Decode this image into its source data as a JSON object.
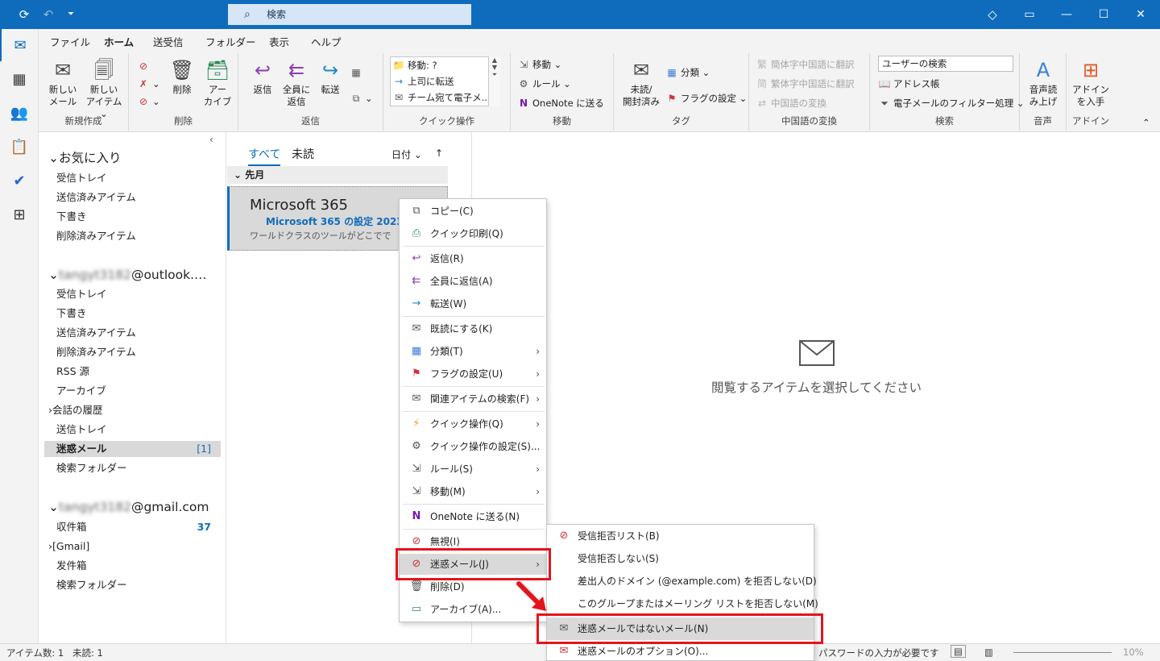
{
  "titlebar": {
    "search_placeholder": "検索"
  },
  "tabs": [
    "ファイル",
    "ホーム",
    "送受信",
    "フォルダー",
    "表示",
    "ヘルプ"
  ],
  "ribbon": {
    "new_group": {
      "label": "新規作成",
      "new_mail_1": "新しい",
      "new_mail_2": "メール",
      "new_item_1": "新しい",
      "new_item_2": "アイテム ⌄"
    },
    "delete_group": {
      "label": "削除",
      "delete": "削除",
      "archive_1": "アー",
      "archive_2": "カイブ"
    },
    "reply_group": {
      "label": "返信",
      "reply": "返信",
      "reply_all_1": "全員に",
      "reply_all_2": "返信",
      "forward": "転送"
    },
    "quick_group": {
      "label": "クイック操作",
      "item1": "移動: ?",
      "item2": "上司に転送",
      "item3": "チーム宛て電子メ..."
    },
    "move_group": {
      "label": "移動",
      "move": "移動 ⌄",
      "rules": "ルール ⌄",
      "onenote": "OneNote に送る"
    },
    "tags_group": {
      "label": "タグ",
      "unread_1": "未読/",
      "unread_2": "開封済み",
      "categorize": "分類 ⌄",
      "flag": "フラグの設定 ⌄"
    },
    "chinese_group": {
      "label": "中国語の変換",
      "item1": "簡体字中国語に翻訳",
      "item2": "繁体字中国語に翻訳",
      "item3": "中国語の変換"
    },
    "search_group": {
      "label": "検索",
      "user_search": "ユーザーの検索",
      "address_book": "アドレス帳",
      "filter": "電子メールのフィルター処理 ⌄"
    },
    "voice_group": {
      "label": "音声",
      "read_aloud_1": "音声読",
      "read_aloud_2": "み上げ"
    },
    "addin_group": {
      "label": "アドイン",
      "get_addins_1": "アドイン",
      "get_addins_2": "を入手"
    }
  },
  "folders": {
    "favorites": {
      "title": "お気に入り",
      "items": [
        "受信トレイ",
        "送信済みアイテム",
        "下書き",
        "削除済みアイテム"
      ]
    },
    "outlook": {
      "account_hidden": "tangyt3182",
      "account_suffix": "@outlook.…",
      "items": [
        "受信トレイ",
        "下書き",
        "送信済みアイテム",
        "削除済みアイテム",
        "RSS 源",
        "アーカイブ",
        "会話の履歴",
        "送信トレイ",
        "迷惑メール",
        "検索フォルダー"
      ],
      "junk_count": "[1]"
    },
    "gmail": {
      "account_hidden": "tangyt3182",
      "account_suffix": "@gmail.com",
      "items": [
        "収件箱",
        "[Gmail]",
        "发件箱",
        "検索フォルダー"
      ],
      "inbox_count": "37"
    }
  },
  "msglist": {
    "filter_all": "すべて",
    "filter_unread": "未読",
    "sort": "日付 ⌄",
    "group": "先月",
    "message": {
      "from": "Microsoft 365",
      "subject": "Microsoft 365 の設定 2023",
      "preview": "ワールドクラスのツールがどこでで"
    }
  },
  "reading": {
    "empty_text": "閲覧するアイテムを選択してください"
  },
  "context_menu": {
    "items": [
      "コピー(C)",
      "クイック印刷(Q)",
      "返信(R)",
      "全員に返信(A)",
      "転送(W)",
      "既読にする(K)",
      "分類(T)",
      "フラグの設定(U)",
      "関連アイテムの検索(F)",
      "クイック操作(Q)",
      "クイック操作の設定(S)...",
      "ルール(S)",
      "移動(M)",
      "OneNote に送る(N)",
      "無視(I)",
      "迷惑メール(J)",
      "削除(D)",
      "アーカイブ(A)..."
    ]
  },
  "submenu": {
    "items": [
      "受信拒否リスト(B)",
      "受信拒否しない(S)",
      "差出人のドメイン (@example.com) を拒否しない(D)",
      "このグループまたはメーリング リストを拒否しない(M)",
      "迷惑メールではないメール(N)",
      "迷惑メールのオプション(O)..."
    ]
  },
  "status": {
    "items": "アイテム数: 1",
    "unread": "未読: 1",
    "password": "パスワードの入力が必要です",
    "zoom": "10%"
  },
  "colors": {
    "accent": "#0f6cbd",
    "highlight_box": "#e5141c"
  }
}
